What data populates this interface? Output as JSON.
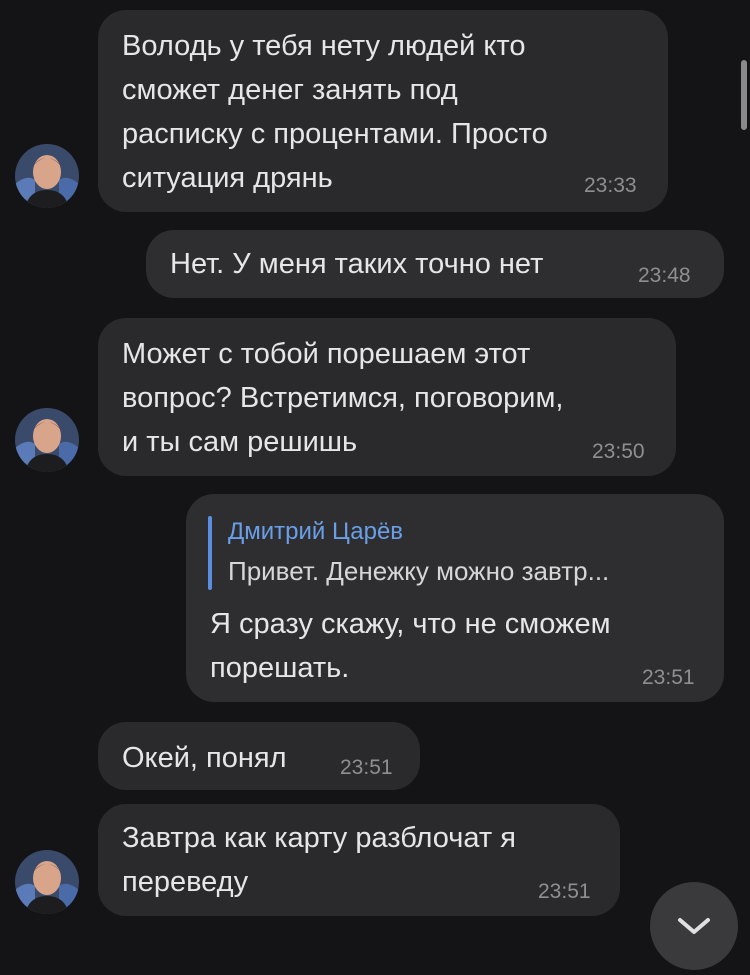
{
  "messages": [
    {
      "id": "m1",
      "direction": "incoming",
      "text": "Володь у тебя нету людей кто\nсможет денег занять под\nрасписку с процентами. Просто\nситуация дрянь",
      "time": "23:33"
    },
    {
      "id": "m2",
      "direction": "outgoing",
      "text": "Нет. У меня таких точно нет",
      "time": "23:48"
    },
    {
      "id": "m3",
      "direction": "incoming",
      "text": "Может с тобой порешаем этот\nвопрос? Встретимся, поговорим,\nи ты сам решишь",
      "time": "23:50"
    },
    {
      "id": "m4",
      "direction": "outgoing",
      "reply_to": {
        "author": "Дмитрий Царёв",
        "text": "Привет. Денежку можно завтр..."
      },
      "text": "Я сразу скажу, что не сможем\nпорешать.",
      "time": "23:51"
    },
    {
      "id": "m5",
      "direction": "incoming",
      "text": "Окей, понял",
      "time": "23:51"
    },
    {
      "id": "m6",
      "direction": "incoming",
      "text": "Завтра как карту разблочат я\nпереведу",
      "time": "23:51"
    }
  ],
  "colors": {
    "background": "#141416",
    "bubble": "#2c2c2e",
    "accent": "#5a8fe0"
  },
  "icons": {
    "scroll_down": "chevron-down-icon"
  }
}
